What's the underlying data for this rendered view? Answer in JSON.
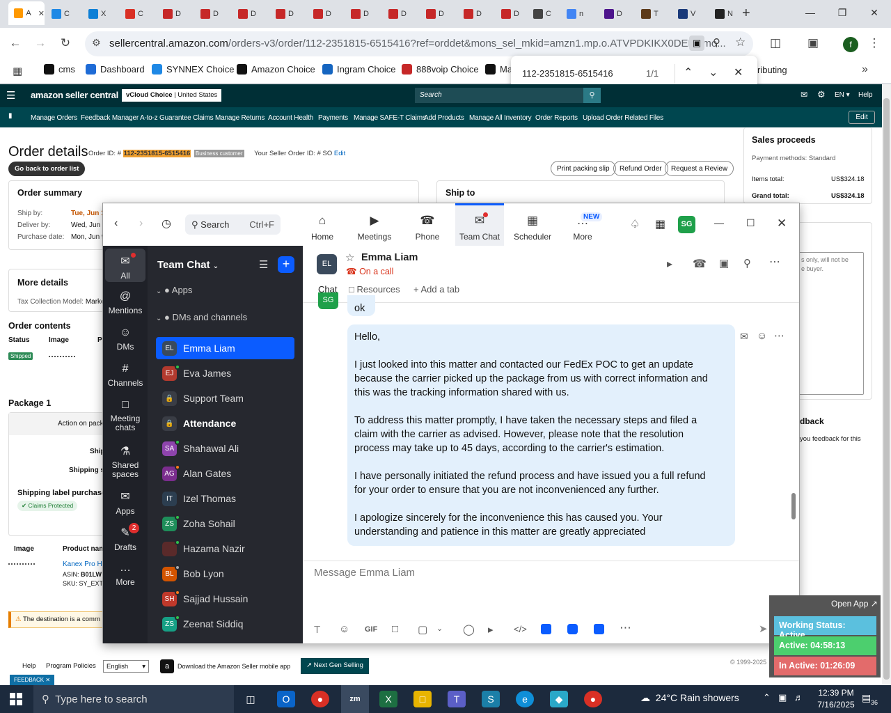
{
  "browser": {
    "tabs": [
      {
        "label": "A",
        "active": true,
        "color": "#ffffff"
      },
      {
        "label": "C",
        "color": "#1e88e5"
      },
      {
        "label": "X",
        "color": "#0d7fd6"
      },
      {
        "label": "C",
        "color": "#d93025"
      },
      {
        "label": "D",
        "color": "#c62828"
      },
      {
        "label": "D",
        "color": "#c62828"
      },
      {
        "label": "D",
        "color": "#c62828"
      },
      {
        "label": "D",
        "color": "#c62828"
      },
      {
        "label": "D",
        "color": "#c62828"
      },
      {
        "label": "D",
        "color": "#c62828"
      },
      {
        "label": "D",
        "color": "#c62828"
      },
      {
        "label": "D",
        "color": "#c62828"
      },
      {
        "label": "D",
        "color": "#c62828"
      },
      {
        "label": "D",
        "color": "#c62828"
      },
      {
        "label": "C",
        "color": "#444444"
      },
      {
        "label": "n",
        "color": "#4285f4"
      },
      {
        "label": "D",
        "color": "#4d148c"
      },
      {
        "label": "T",
        "color": "#5d3a1a"
      },
      {
        "label": "V",
        "color": "#1a3a7a"
      },
      {
        "label": "N",
        "color": "#222222"
      }
    ],
    "new_tab": "+",
    "url_main": "sellercentral.amazon.com",
    "url_rest": "/orders-v3/order/112-2351815-6515416?ref=orddet&mons_sel_mkid=amzn1.mp.o.ATVPDKIKX0DER&mo...",
    "profile_initial": "f",
    "bookmarks": [
      {
        "label": "cms",
        "color": "#111111"
      },
      {
        "label": "Dashboard",
        "color": "#1e6bd6"
      },
      {
        "label": "SYNNEX Choice",
        "color": "#1e88e5"
      },
      {
        "label": "Amazon Choice",
        "color": "#111111"
      },
      {
        "label": "Ingram Choice",
        "color": "#1565c0"
      },
      {
        "label": "888voip Choice",
        "color": "#c62828"
      },
      {
        "label": "Ma",
        "color": "#111111"
      }
    ],
    "bookmarks_tail": "ributing",
    "find": {
      "query": "112-2351815-6515416",
      "count": "1/1"
    }
  },
  "seller": {
    "logo": "amazon seller central",
    "store_name": "vCloud Choice",
    "store_region": "United States",
    "search_placeholder": "Search",
    "lang": "EN",
    "help": "Help",
    "nav": [
      "Manage Orders",
      "Feedback Manager",
      "A-to-z Guarantee Claims",
      "Manage Returns",
      "Account Health",
      "Payments",
      "Manage SAFE-T Claims",
      "Add Products",
      "Manage All Inventory",
      "Order Reports",
      "Upload Order Related Files"
    ],
    "edit": "Edit",
    "title": "Order details",
    "order_id_label": "Order ID: #",
    "order_id": "112-2351815-6515416",
    "business_badge": "Business customer",
    "seller_order_id": "Your Seller Order ID: # SO",
    "seller_order_edit": "Edit",
    "back_button": "Go back to order list",
    "actions": [
      "Print packing slip",
      "Refund Order",
      "Request a Review"
    ],
    "order_summary": "Order summary",
    "ship_by_label": "Ship by:",
    "ship_by": "Tue, Jun 1",
    "deliver_by_label": "Deliver by:",
    "deliver_by": "Wed, Jun 1",
    "purchase_label": "Purchase date:",
    "purchase": "Mon, Jun 9",
    "ship_to": "Ship to",
    "more_details": "More details",
    "tax_model": "Tax Collection Model:",
    "tax_val": "Marke",
    "order_contents": "Order contents",
    "col_status": "Status",
    "col_image": "Image",
    "col_p": "P",
    "status_shipped": "Shipped",
    "package": "Package 1",
    "action_on": "Action on pack",
    "ship_frag": "Ship",
    "shipping_s": "Shipping s",
    "shipping_label_purchase": "Shipping label purchase",
    "claims_protected": "Claims Protected",
    "col_image2": "Image",
    "col_product": "Product nam",
    "product": "Kanex Pro HD",
    "asin_label": "ASIN:",
    "asin": "B01LW",
    "sku": "SKU: SY_EXT-",
    "warning": "The destination is a comm",
    "sales_proceeds": "Sales proceeds",
    "payment_methods": "Payment methods: Standard",
    "items_total_label": "Items total:",
    "items_total": "US$324.18",
    "grand_total_label": "Grand total:",
    "grand_total": "US$324.18",
    "note_frag1": "s only, will not be",
    "note_frag2": "e buyer.",
    "feedback_head": "dback",
    "feedback_text": "you feedback for this",
    "footer_help": "Help",
    "footer_policies": "Program Policies",
    "footer_lang": "English",
    "footer_app": "Download the Amazon Seller mobile app",
    "footer_next": "Next Gen Selling",
    "copyright": "© 1999-2025",
    "feedback_tab": "FEEDBACK"
  },
  "zoom": {
    "search": "Search",
    "search_shortcut": "Ctrl+F",
    "tabs": [
      "Home",
      "Meetings",
      "Phone",
      "Team Chat",
      "Scheduler",
      "More"
    ],
    "new_badge": "NEW",
    "avatar": "SG",
    "rail": [
      {
        "label": "All"
      },
      {
        "label": "Mentions"
      },
      {
        "label": "DMs"
      },
      {
        "label": "Channels"
      },
      {
        "label": "Meeting chats"
      },
      {
        "label": "Shared spaces"
      },
      {
        "label": "Apps"
      },
      {
        "label": "Drafts",
        "badge": "2"
      },
      {
        "label": "More"
      }
    ],
    "list_title": "Team Chat",
    "sections": [
      "Apps",
      "DMs and channels"
    ],
    "contacts": [
      {
        "initials": "EL",
        "name": "Emma Liam",
        "color": "#3a4a5c"
      },
      {
        "initials": "EJ",
        "name": "Eva James",
        "color": "#b23a2e"
      },
      {
        "initials": "",
        "name": "Support Team",
        "color": "#3a3d45"
      },
      {
        "initials": "",
        "name": "Attendance",
        "color": "#3a3d45"
      },
      {
        "initials": "SA",
        "name": "Shahawal Ali",
        "color": "#8e44ad"
      },
      {
        "initials": "AG",
        "name": "Alan Gates",
        "color": "#7b2d8e"
      },
      {
        "initials": "IT",
        "name": "Izel Thomas",
        "color": "#2c3e50"
      },
      {
        "initials": "ZS",
        "name": "Zoha Sohail",
        "color": "#1e8e5a"
      },
      {
        "initials": "",
        "name": "Hazama Nazir",
        "color": "#5a2a2a"
      },
      {
        "initials": "BL",
        "name": "Bob Lyon",
        "color": "#d35400"
      },
      {
        "initials": "SH",
        "name": "Sajjad Hussain",
        "color": "#c0392b"
      },
      {
        "initials": "ZS",
        "name": "Zeenat Siddiq",
        "color": "#16a085"
      }
    ],
    "contact_initials": "EL",
    "contact_name": "Emma Liam",
    "contact_status": "On a call",
    "chat_tabs": [
      "Chat",
      "Resources",
      "Add a tab"
    ],
    "sender_initials": "SG",
    "prev_message": "ok",
    "message_lines": [
      "Hello,",
      "",
      "I just looked into this matter and contacted our FedEx POC to get an update",
      "because the carrier picked up the package from us with correct information and",
      "this was the tracking information shared with us.",
      "",
      "To address this matter promptly, I have taken the necessary steps and filed a",
      "claim with the carrier as advised. However, please note that the resolution",
      "process may take up to 45 days, according to the carrier's estimation.",
      "",
      "I have personally initiated the refund process and have issued you a full refund",
      "for your order to ensure that you are not inconvenienced any further.",
      "",
      "I apologize sincerely for the inconvenience this has caused you. Your",
      "understanding and patience in this matter are greatly appreciated"
    ],
    "composer_placeholder": "Message Emma Liam",
    "gif": "GIF"
  },
  "status_widget": {
    "open_app": "Open App",
    "working": "Working Status: Active",
    "active": "Active: 04:58:13",
    "inactive": "In Active: 01:26:09"
  },
  "taskbar": {
    "search_placeholder": "Type here to search",
    "weather": "24°C  Rain showers",
    "time": "12:39 PM",
    "date": "7/16/2025",
    "notif_count": "36"
  },
  "colors": {
    "accent": "#0b5cff",
    "amazon_dark": "#002f36",
    "amazon_nav": "#00464f",
    "highlight": "#f0a030"
  }
}
